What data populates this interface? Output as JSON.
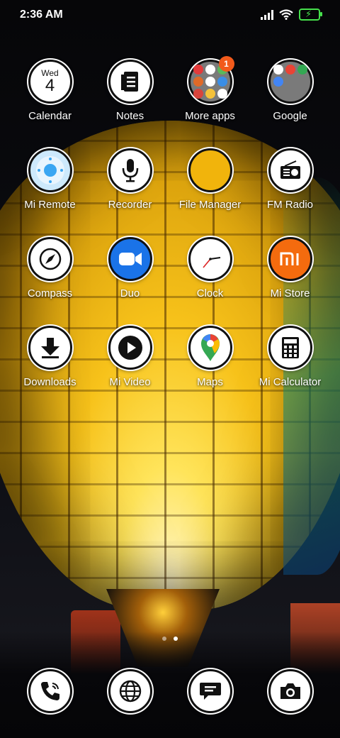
{
  "status_bar": {
    "time": "2:36 AM",
    "icons": [
      "signal-icon",
      "wifi-icon",
      "battery-charging-icon"
    ],
    "battery_color": "#46e04c"
  },
  "apps": [
    {
      "label": "Calendar",
      "icon": "calendar-icon",
      "day": "Wed",
      "date": "4"
    },
    {
      "label": "Notes",
      "icon": "notes-icon"
    },
    {
      "label": "More apps",
      "icon": "folder-icon",
      "badge": "1",
      "badge_color": "#f25a1b"
    },
    {
      "label": "Google",
      "icon": "google-folder-icon"
    },
    {
      "label": "Mi Remote",
      "icon": "mi-remote-icon",
      "color": "#3aa6f2"
    },
    {
      "label": "Recorder",
      "icon": "microphone-icon"
    },
    {
      "label": "File Manager",
      "icon": "file-manager-icon",
      "color": "#f1b40c"
    },
    {
      "label": "FM Radio",
      "icon": "radio-icon"
    },
    {
      "label": "Compass",
      "icon": "compass-icon"
    },
    {
      "label": "Duo",
      "icon": "duo-video-icon",
      "color": "#1a73e8"
    },
    {
      "label": "Clock",
      "icon": "clock-icon"
    },
    {
      "label": "Mi Store",
      "icon": "mi-store-icon",
      "color": "#f46b0e"
    },
    {
      "label": "Downloads",
      "icon": "download-icon"
    },
    {
      "label": "Mi Video",
      "icon": "play-icon"
    },
    {
      "label": "Maps",
      "icon": "maps-pin-icon"
    },
    {
      "label": "Mi Calculator",
      "icon": "calculator-icon"
    }
  ],
  "page_indicator": {
    "count": 2,
    "active": 2
  },
  "dock": [
    {
      "icon": "phone-icon"
    },
    {
      "icon": "browser-globe-icon"
    },
    {
      "icon": "messages-icon"
    },
    {
      "icon": "camera-icon"
    }
  ]
}
